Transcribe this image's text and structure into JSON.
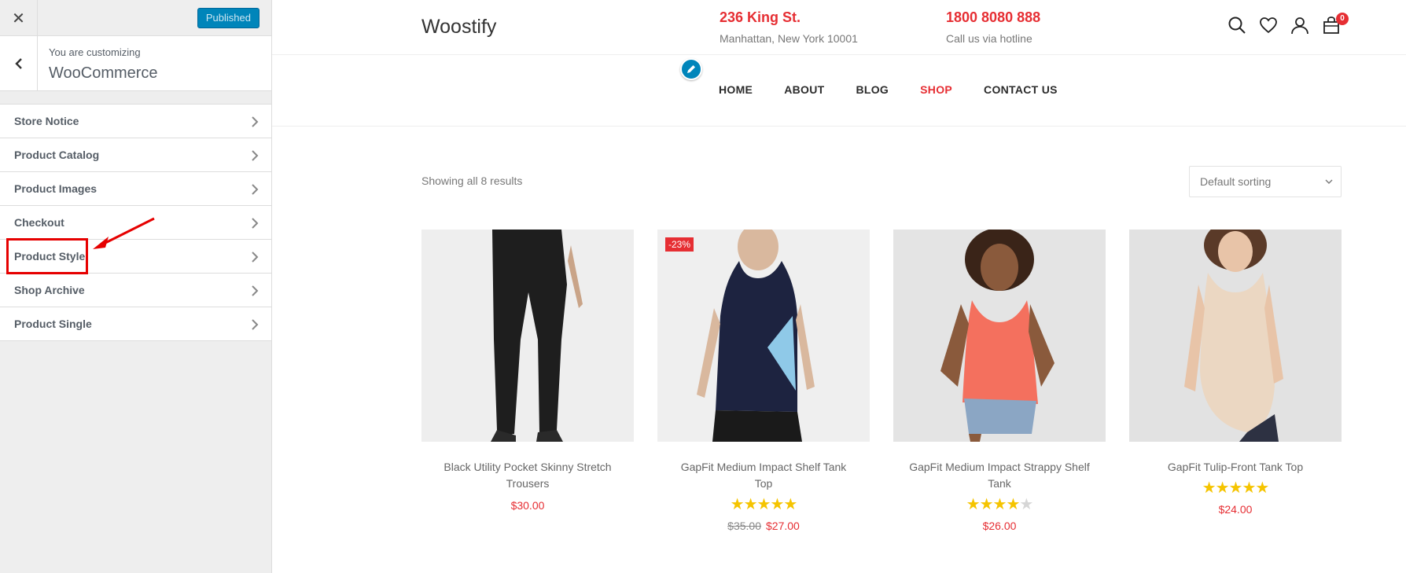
{
  "sidebar": {
    "close_glyph": "✕",
    "publish_label": "Published",
    "customizing_label": "You are customizing",
    "customizing_name": "WooCommerce",
    "items": [
      {
        "label": "Store Notice"
      },
      {
        "label": "Product Catalog"
      },
      {
        "label": "Product Images"
      },
      {
        "label": "Checkout"
      },
      {
        "label": "Product Style"
      },
      {
        "label": "Shop Archive"
      },
      {
        "label": "Product Single"
      }
    ]
  },
  "site": {
    "title": "Woostify",
    "address": {
      "title": "236 King St.",
      "sub": "Manhattan, New York 10001"
    },
    "phone": {
      "title": "1800 8080 888",
      "sub": "Call us via hotline"
    },
    "cart_count": "0",
    "nav": [
      "HOME",
      "ABOUT",
      "BLOG",
      "SHOP",
      "CONTACT US"
    ],
    "active_nav": "SHOP",
    "accent_color": "#e62e33"
  },
  "shop": {
    "results_text": "Showing all 8 results",
    "sort_value": "Default sorting",
    "products": [
      {
        "title": "Black Utility Pocket Skinny Stretch Trousers",
        "price": "$30.00",
        "old_price": "",
        "rating": null,
        "badge": ""
      },
      {
        "title": "GapFit Medium Impact Shelf Tank Top",
        "price": "$27.00",
        "old_price": "$35.00",
        "rating": 5,
        "badge": "-23%"
      },
      {
        "title": "GapFit Medium Impact Strappy Shelf Tank",
        "price": "$26.00",
        "old_price": "",
        "rating": 4.5,
        "badge": ""
      },
      {
        "title": "GapFit Tulip-Front Tank Top",
        "price": "$24.00",
        "old_price": "",
        "rating": 5,
        "badge": ""
      }
    ]
  }
}
